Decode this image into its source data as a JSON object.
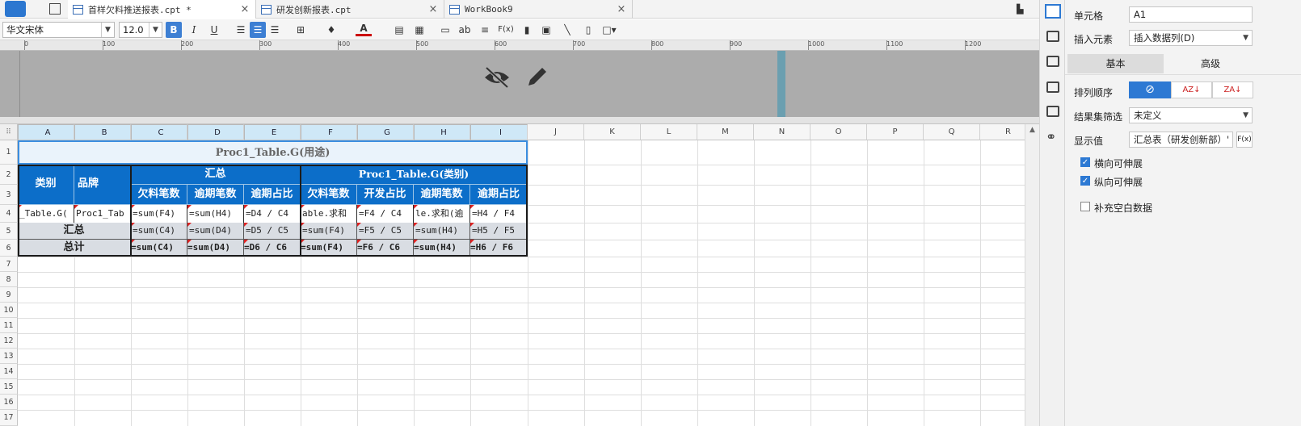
{
  "tabs": [
    {
      "name": "首样欠料推送报表.cpt *",
      "active": true
    },
    {
      "name": "研发创新报表.cpt",
      "active": false
    },
    {
      "name": "WorkBook9",
      "active": false
    }
  ],
  "toolbar": {
    "font_family": "华文宋体",
    "font_size": "12.0",
    "bold_label": "B",
    "italic_label": "I",
    "underline_label": "U",
    "text_ab": "ab",
    "formula_label": "F(x)"
  },
  "ruler": {
    "ticks": [
      "0",
      "100",
      "200",
      "300",
      "400",
      "500",
      "600",
      "700",
      "800",
      "900",
      "1000",
      "1100",
      "1200"
    ]
  },
  "grid": {
    "columns": [
      "A",
      "B",
      "C",
      "D",
      "E",
      "F",
      "G",
      "H",
      "I",
      "J",
      "K",
      "L",
      "M",
      "N",
      "O",
      "P",
      "Q",
      "R"
    ],
    "rows": [
      "1",
      "2",
      "3",
      "4",
      "5",
      "6",
      "7",
      "8",
      "9",
      "10",
      "11",
      "12",
      "13",
      "14",
      "15",
      "16",
      "17"
    ],
    "title": "Proc1_Table.G(用途)",
    "cat_header": "类别",
    "brand_header": "品牌",
    "summary_header": "汇总",
    "group_header": "Proc1_Table.G(类别)",
    "sub_headers": [
      "欠料笔数",
      "逾期笔数",
      "逾期占比",
      "欠料笔数",
      "开发占比",
      "逾期笔数",
      "逾期占比"
    ],
    "row4": [
      "_Table.G(",
      "Proc1_Tab",
      "=sum(F4)",
      "=sum(H4)",
      "=D4 / C4",
      "able.求和",
      "=F4 / C4",
      "le.求和(逾",
      "=H4 / F4"
    ],
    "row5_label": "汇总",
    "row5": [
      "=sum(C4)",
      "=sum(D4)",
      "=D5 / C5",
      "=sum(F4)",
      "=F5 / C5",
      "=sum(H4)",
      "=H5 / F5"
    ],
    "row6_label": "总计",
    "row6": [
      "=sum(C4)",
      "=sum(D4)",
      "=D6 / C6",
      "=sum(F4)",
      "=F6 / C6",
      "=sum(H4)",
      "=H6 / F6"
    ]
  },
  "panel": {
    "cell_label": "单元格",
    "cell_value": "A1",
    "insert_label": "插入元素",
    "insert_value": "插入数据列(D)",
    "tab_basic": "基本",
    "tab_advanced": "高级",
    "sort_label": "排列顺序",
    "filter_label": "结果集筛选",
    "filter_value": "未定义",
    "display_label": "显示值",
    "display_value": "汇总表（研发创新部）'",
    "formula_btn": "F(x)",
    "chk_horizontal": "横向可伸展",
    "chk_vertical": "纵向可伸展",
    "chk_fill": "补充空白数据",
    "chk_horizontal_on": true,
    "chk_vertical_on": true,
    "chk_fill_on": false
  },
  "colors": {
    "header_blue": "#0c6ec9",
    "total_gray": "#d9dde3",
    "accent": "#2d79d3"
  }
}
